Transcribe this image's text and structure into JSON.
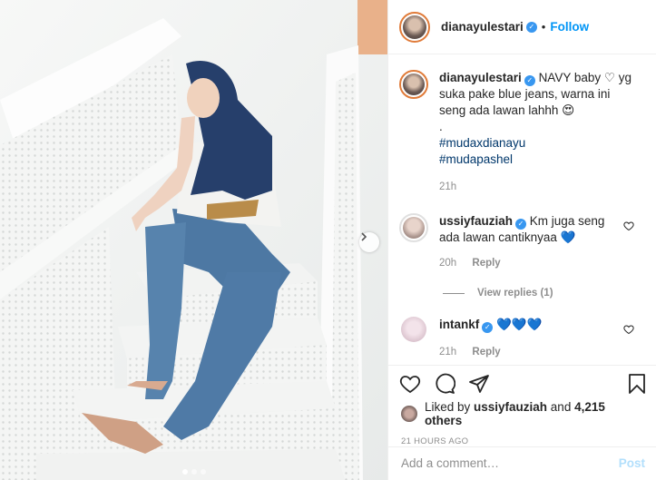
{
  "header": {
    "username": "dianayulestari",
    "separator": "•",
    "follow_label": "Follow"
  },
  "caption": {
    "username": "dianayulestari",
    "text": "NAVY baby ♡ yg suka pake blue jeans, warna ini seng ada lawan lahhh 😍",
    "dot": ".",
    "hashtags": [
      "#mudaxdianayu",
      "#mudapashel"
    ],
    "time": "21h"
  },
  "comments": [
    {
      "username": "ussiyfauziah",
      "text": "Km juga seng ada lawan cantiknyaa 💙",
      "time": "20h",
      "reply_label": "Reply",
      "view_replies": "View replies (1)"
    },
    {
      "username": "intankf",
      "text": "💙💙💙",
      "time": "21h",
      "reply_label": "Reply"
    }
  ],
  "likes": {
    "prefix": "Liked by",
    "liker": "ussiyfauziah",
    "conjunction": "and",
    "others": "4,215 others"
  },
  "timestamp": "21 HOURS AGO",
  "add_comment": {
    "placeholder": "Add a comment…",
    "post_label": "Post"
  },
  "carousel": {
    "slides": 3,
    "active_index": 0
  },
  "icons": {
    "like": "heart-icon",
    "comment": "comment-icon",
    "share": "share-icon",
    "save": "bookmark-icon",
    "next": "chevron-right-icon"
  },
  "colors": {
    "link_blue": "#0095f6",
    "verified_blue": "#3897f0",
    "text": "#262626",
    "muted": "#8e8e8e",
    "post_disabled": "#b2dffc",
    "hashtag": "#00376b"
  }
}
